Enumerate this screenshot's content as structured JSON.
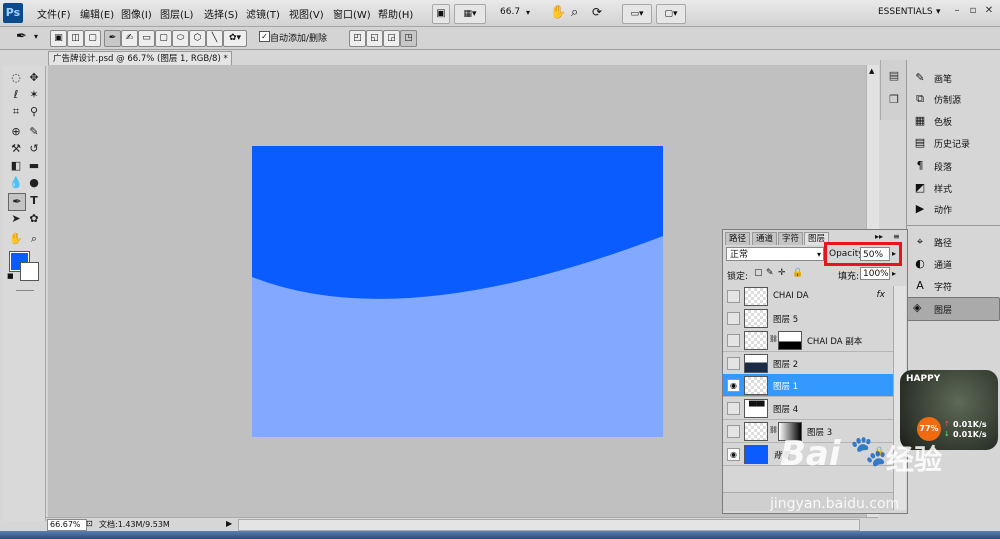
{
  "menubar": {
    "logo": "Ps",
    "items": [
      "文件(F)",
      "编辑(E)",
      "图像(I)",
      "图层(L)",
      "选择(S)",
      "滤镜(T)",
      "视图(V)",
      "窗口(W)",
      "帮助(H)"
    ],
    "zoom": "66.7",
    "workspace": "ESSENTIALS",
    "workspace_arrow": "▾"
  },
  "options": {
    "auto_add_delete": "自动添加/删除",
    "auto_add_checked": "✓"
  },
  "document": {
    "tab_title": "广告牌设计.psd @ 66.7% (图层 1, RGB/8) *",
    "zoom_status": "66.67%",
    "doc_info": "文档:1.43M/9.53M",
    "top_color": "#0a5cff",
    "bottom_color": "#82a8ff"
  },
  "colors": {
    "foreground": "#0a5cff",
    "background": "#ffffff",
    "selection": "#3399ff",
    "highlight": "#e8141c"
  },
  "dock": {
    "items": [
      {
        "icon": "brush-icon",
        "glyph": "✎",
        "label": "画笔"
      },
      {
        "icon": "clone-source-icon",
        "glyph": "⧉",
        "label": "仿制源"
      },
      {
        "icon": "swatches-icon",
        "glyph": "▦",
        "label": "色板"
      },
      {
        "icon": "history-icon",
        "glyph": "▤",
        "label": "历史记录"
      },
      {
        "icon": "paragraph-icon",
        "glyph": "¶",
        "label": "段落"
      },
      {
        "icon": "styles-icon",
        "glyph": "◩",
        "label": "样式"
      },
      {
        "icon": "actions-icon",
        "glyph": "▶",
        "label": "动作"
      },
      {
        "icon": "paths-icon",
        "glyph": "⌖",
        "label": "路径"
      },
      {
        "icon": "channels-icon",
        "glyph": "◐",
        "label": "通道"
      },
      {
        "icon": "character-icon",
        "glyph": "A",
        "label": "字符"
      },
      {
        "icon": "layers-icon",
        "glyph": "◈",
        "label": "图层"
      }
    ]
  },
  "layers_panel": {
    "tabs": [
      "路径",
      "通道",
      "字符",
      "图层"
    ],
    "blend_mode": "正常",
    "opacity_label": "Opacity:",
    "opacity_value": "50%",
    "lock_label": "锁定:",
    "fill_label": "填充:",
    "fill_value": "100%",
    "fx_label": "fx",
    "layers": [
      {
        "name": "CHAI DA",
        "visible": false,
        "fx": true,
        "mask": false,
        "selected": false
      },
      {
        "name": "图层 5",
        "visible": false,
        "fx": false,
        "mask": false,
        "selected": false
      },
      {
        "name": "CHAI DA 副本",
        "visible": false,
        "fx": false,
        "mask": true,
        "selected": false
      },
      {
        "name": "图层 2",
        "visible": false,
        "fx": false,
        "mask": false,
        "selected": false
      },
      {
        "name": "图层 1",
        "visible": true,
        "fx": false,
        "mask": false,
        "selected": true
      },
      {
        "name": "图层 4",
        "visible": false,
        "fx": false,
        "mask": false,
        "selected": false
      },
      {
        "name": "图层 3",
        "visible": false,
        "fx": false,
        "mask": true,
        "selected": false
      },
      {
        "name": "背景",
        "visible": true,
        "fx": false,
        "mask": false,
        "selected": false
      }
    ]
  },
  "widget": {
    "title": "HAPPY",
    "percent": "77%",
    "upload": "0.01K/s",
    "download": "0.01K/s"
  },
  "watermark": {
    "brand": "Bai",
    "brand_cn": "经验",
    "url": "jingyan.baidu.com"
  }
}
